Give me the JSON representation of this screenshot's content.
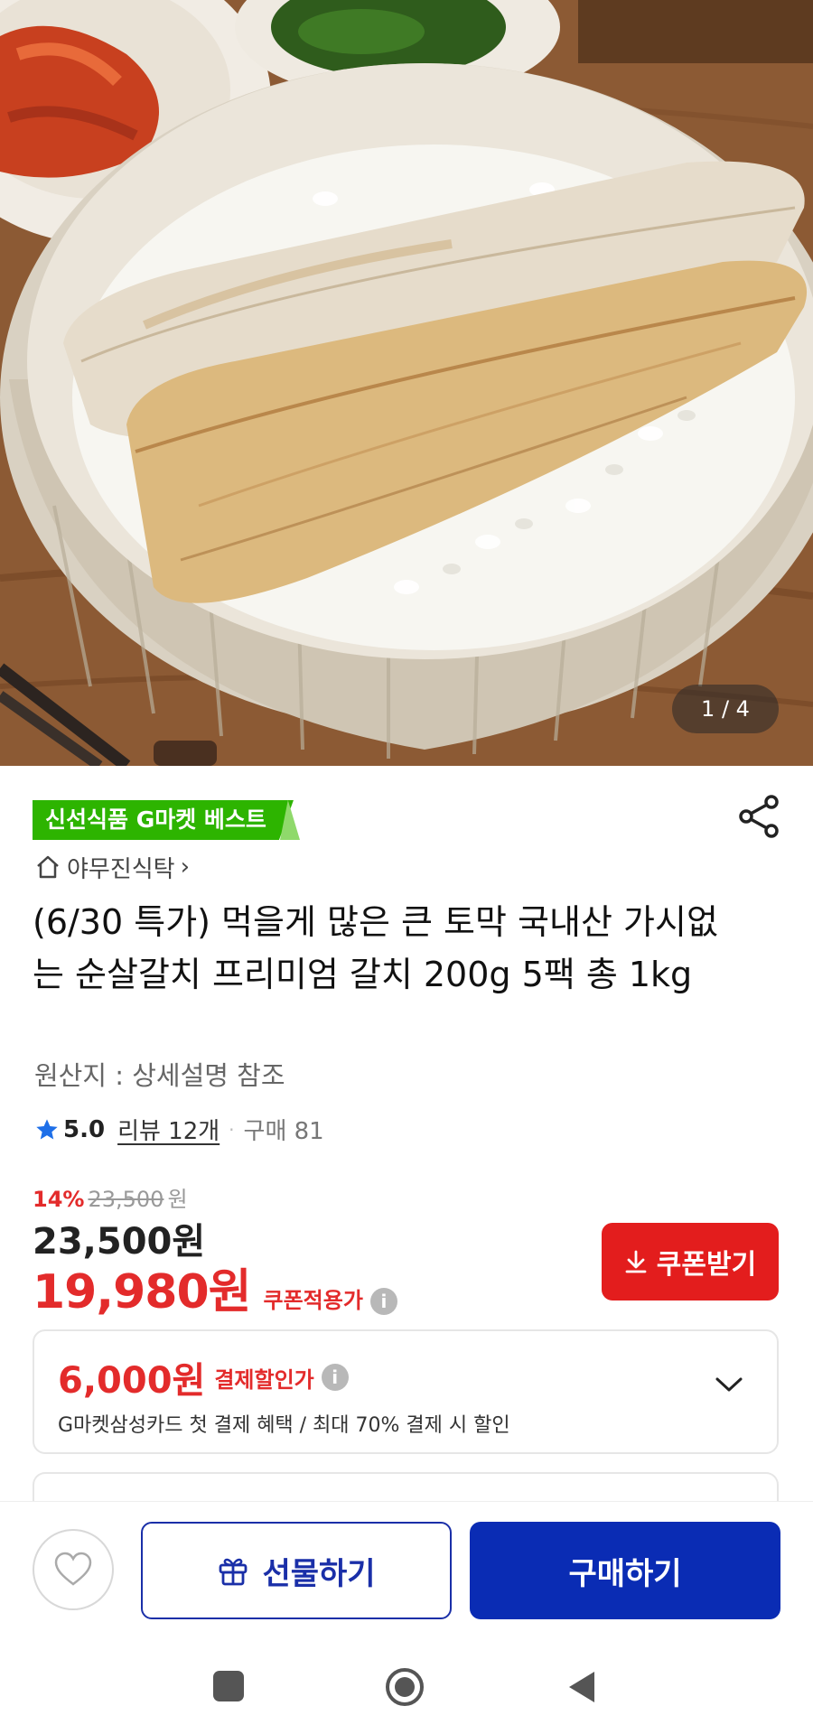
{
  "hero": {
    "image_alt": "",
    "counter": "1 / 4"
  },
  "product": {
    "badge": "신선식품 G마켓 베스트",
    "store_name": "야무진식탁",
    "store_chevron": "›",
    "title": "(6/30 특가) 먹을게 많은 큰 토막 국내산 가시없는 순살갈치 프리미엄 갈치 200g 5팩 총 1kg",
    "origin": "원산지 : 상세설명 참조",
    "rating": {
      "score": "5.0",
      "reviews": "리뷰 12개",
      "separator": "·",
      "purchases": "구매 81"
    }
  },
  "pricing": {
    "discount_percent": "14%",
    "original_price": "23,500",
    "original_unit": "원",
    "price": "23,500원",
    "coupon_price": "19,980원",
    "coupon_label": "쿠폰적용가",
    "coupon_button": "쿠폰받기"
  },
  "card_offer": {
    "amount": "6,000원",
    "label": "결제할인가",
    "description": "G마켓삼성카드 첫 결제 혜택 / 최대 70% 결제 시 할인"
  },
  "bottom_bar": {
    "gift_label": "선물하기",
    "buy_label": "구매하기"
  },
  "icons": {
    "share": "share-icon",
    "home": "home-icon",
    "star": "star-icon",
    "info": "info-icon",
    "download": "download-icon",
    "chevron": "chevron-down-icon",
    "heart": "heart-icon",
    "gift": "gift-icon"
  },
  "colors": {
    "badge_green": "#2db400",
    "discount_red": "#e32b2b",
    "coupon_button": "#e31d1d",
    "primary_blue": "#0a2cb4",
    "star_blue": "#1e6fe8"
  }
}
